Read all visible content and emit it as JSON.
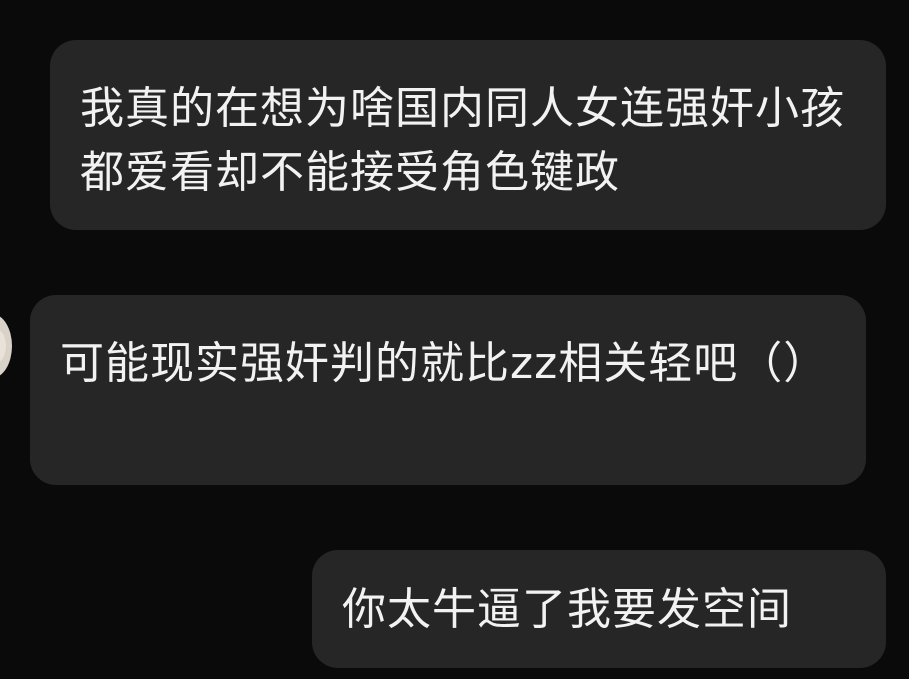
{
  "messages": [
    {
      "id": "msg-1",
      "side": "left",
      "text": "我真的在想为啥国内同人女连强奸小孩都爱看却不能接受角色键政"
    },
    {
      "id": "msg-2",
      "side": "left",
      "text": "可能现实强奸判的就比zz相关轻吧（）"
    },
    {
      "id": "msg-3",
      "side": "right",
      "text": "你太牛逼了我要发空间"
    }
  ],
  "colors": {
    "background": "#0a0a0a",
    "bubble": "#262626",
    "text": "#f2f2f2"
  }
}
